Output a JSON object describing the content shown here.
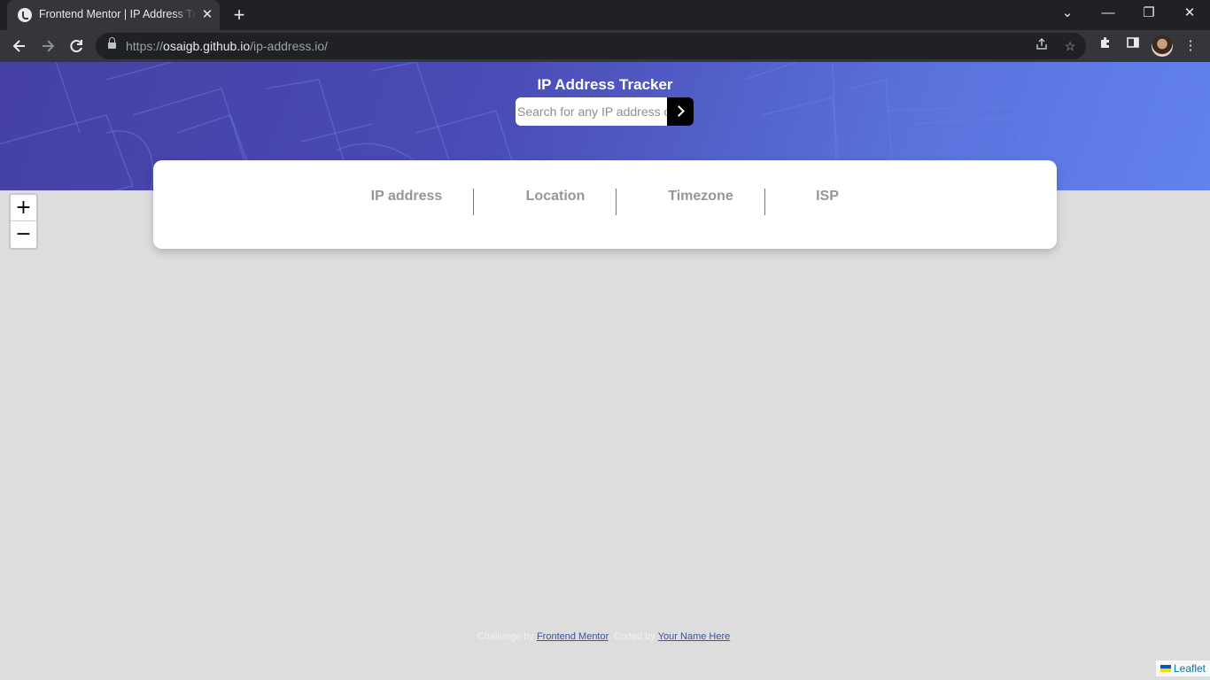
{
  "browser": {
    "tab_title": "Frontend Mentor | IP Address Tracker",
    "tab_close": "✕",
    "new_tab": "+",
    "url_scheme": "https://",
    "url_host": "osaigb.github.io",
    "url_path": "/ip-address.io/",
    "window_controls": {
      "tabs_menu": "⌄",
      "minimize": "—",
      "restore": "❐",
      "close": "✕"
    },
    "nav_icons": {
      "back": "back-icon",
      "forward": "forward-icon",
      "reload": "reload-icon"
    }
  },
  "header": {
    "title": "IP Address Tracker",
    "search_placeholder": "Search for any IP address or domain"
  },
  "info": {
    "items": [
      {
        "label": "IP address"
      },
      {
        "label": "Location"
      },
      {
        "label": "Timezone"
      },
      {
        "label": "ISP"
      }
    ]
  },
  "map": {
    "zoom_in": "+",
    "zoom_out": "−",
    "leaflet_label": "Leaflet"
  },
  "attribution": {
    "challenge_prefix": "Challenge by ",
    "challenge_link": "Frontend Mentor",
    "coded_prefix": ". Coded by ",
    "coded_link": "Your Name Here",
    "suffix": "."
  },
  "colors": {
    "hero_start": "#4640a3",
    "hero_end": "#6382ee",
    "map_bg": "#dddddd",
    "link": "#3e52a3"
  }
}
